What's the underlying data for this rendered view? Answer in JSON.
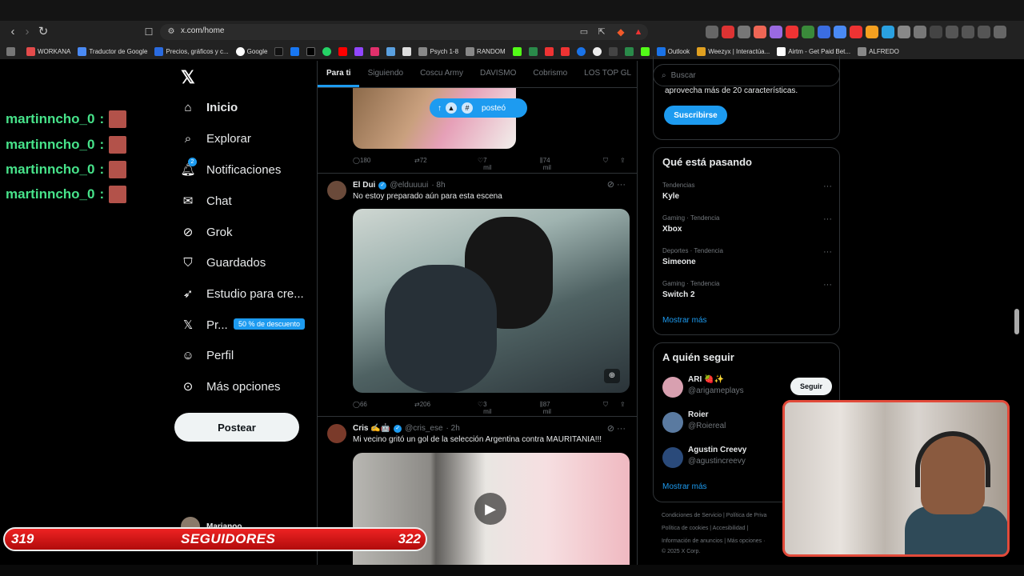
{
  "browser": {
    "url": "x.com/home",
    "bookmarks": [
      {
        "label": "WORKANA",
        "color": "#e34b4b"
      },
      {
        "label": "Traductor de Google",
        "color": "#4a8af4"
      },
      {
        "label": "Precios, gráficos y c...",
        "color": "#2a6be0"
      },
      {
        "label": "Google",
        "color": "#ffffff"
      },
      {
        "label": "Psych 1-8",
        "color": "#888888"
      },
      {
        "label": "RANDOM",
        "color": "#888888"
      },
      {
        "label": "Outlook",
        "color": "#1a73e8"
      },
      {
        "label": "Weezyx | Interactúa...",
        "color": "#e0a020"
      },
      {
        "label": "Airtm - Get Paid Bet...",
        "color": "#ffffff"
      },
      {
        "label": "ALFREDO",
        "color": "#888888"
      }
    ]
  },
  "stream_chat": {
    "username": "martinncho_0",
    "separator": ":",
    "lines": 4
  },
  "sidebar": {
    "items": [
      {
        "label": "Inicio",
        "icon": "home-icon"
      },
      {
        "label": "Explorar",
        "icon": "search-icon"
      },
      {
        "label": "Notificaciones",
        "icon": "bell-icon",
        "badge": "2"
      },
      {
        "label": "Chat",
        "icon": "mail-icon"
      },
      {
        "label": "Grok",
        "icon": "grok-icon"
      },
      {
        "label": "Guardados",
        "icon": "bookmark-icon"
      },
      {
        "label": "Estudio para cre...",
        "icon": "rocket-icon"
      },
      {
        "label": "Pr...",
        "icon": "x-premium-icon"
      },
      {
        "label": "Perfil",
        "icon": "user-icon"
      },
      {
        "label": "Más opciones",
        "icon": "more-icon"
      }
    ],
    "promo_badge": "50 % de descuento",
    "post_button": "Postear",
    "account_name": "Marianoo"
  },
  "timeline": {
    "tabs": [
      "Para ti",
      "Siguiendo",
      "Coscu Army",
      "DAVISMO",
      "Cobrismo",
      "LOS TOP GL"
    ],
    "new_posts_label": "posteó",
    "posts": [
      {
        "stats": {
          "replies": "180",
          "reposts": "72",
          "likes": "7 mil",
          "views": "74 mil"
        }
      },
      {
        "author": "El Dui",
        "handle": "@elduuuui",
        "time": "· 8h",
        "text": "No estoy preparado aún para esta escena",
        "stats": {
          "replies": "66",
          "reposts": "206",
          "likes": "3 mil",
          "views": "87 mil"
        }
      },
      {
        "author": "Cris ✍️🤖",
        "handle": "@cris_ese",
        "time": "· 2h",
        "text": "Mi vecino gritó un gol de la selección Argentina contra MAURITANIA!!!"
      }
    ]
  },
  "right": {
    "search_placeholder": "Buscar",
    "subscribe_text": "aprovecha más de 20 características.",
    "subscribe_button": "Suscribirse",
    "trends_title": "Qué está pasando",
    "trends": [
      {
        "context": "Tendencias",
        "name": "Kyle"
      },
      {
        "context": "Gaming · Tendencia",
        "name": "Xbox"
      },
      {
        "context": "Deportes · Tendencia",
        "name": "Simeone"
      },
      {
        "context": "Gaming · Tendencia",
        "name": "Switch 2"
      }
    ],
    "show_more": "Mostrar más",
    "who_to_follow_title": "A quién seguir",
    "follow": [
      {
        "name": "ARI 🍓✨",
        "handle": "@arigameplays"
      },
      {
        "name": "Roier",
        "handle": "@Roiereal"
      },
      {
        "name": "Agustin Creevy",
        "handle": "@agustincreevy"
      }
    ],
    "follow_button": "Seguir",
    "footer": {
      "line1": "Condiciones de Servicio  |  Política de Priva",
      "line2": "Política de cookies  |  Accesibilidad  |",
      "line3": "Información de anuncios  |  Más opciones ·",
      "line4": "© 2025 X Corp."
    }
  },
  "followers_bar": {
    "current": "319",
    "label": "SEGUIDORES",
    "goal": "322"
  }
}
